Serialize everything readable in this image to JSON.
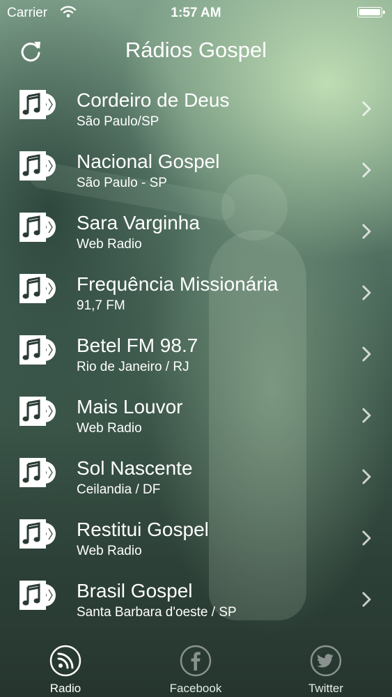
{
  "status_bar": {
    "carrier": "Carrier",
    "time": "1:57 AM"
  },
  "nav": {
    "title": "Rádios Gospel",
    "refresh_icon": "refresh-icon"
  },
  "stations": [
    {
      "name": "Cordeiro de Deus",
      "location": "São Paulo/SP"
    },
    {
      "name": "Nacional Gospel",
      "location": "São Paulo - SP"
    },
    {
      "name": "Sara Varginha",
      "location": "Web Radio"
    },
    {
      "name": "Frequência Missionária",
      "location": "91,7 FM"
    },
    {
      "name": "Betel FM 98.7",
      "location": "Rio de Janeiro / RJ"
    },
    {
      "name": "Mais Louvor",
      "location": "Web Radio"
    },
    {
      "name": "Sol Nascente",
      "location": "Ceilandia / DF"
    },
    {
      "name": "Restitui Gospel",
      "location": "Web Radio"
    },
    {
      "name": "Brasil Gospel",
      "location": "Santa Barbara d'oeste / SP"
    }
  ],
  "tabs": [
    {
      "label": "Radio",
      "icon": "rss-icon",
      "selected": true
    },
    {
      "label": "Facebook",
      "icon": "facebook-icon",
      "selected": false
    },
    {
      "label": "Twitter",
      "icon": "twitter-icon",
      "selected": false
    }
  ],
  "colors": {
    "text": "#ffffff",
    "background_top": "#7d9f89",
    "background_bottom": "#26362f"
  }
}
